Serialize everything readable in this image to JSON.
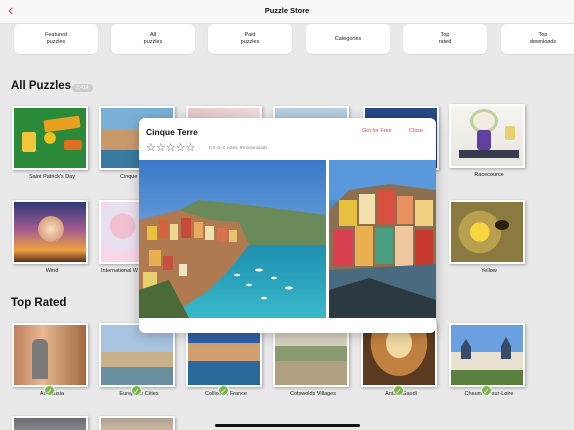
{
  "header": {
    "title": "Puzzle Store",
    "back_icon": "chevron-left-icon"
  },
  "chips": [
    "Featured\npuzzles",
    "All\npuzzles",
    "Paid\npuzzles",
    "Categories",
    "Top\nrated",
    "Top\ndownloads"
  ],
  "all_puzzles": {
    "heading": "All Puzzles",
    "badge": "2,414",
    "items": [
      "Saint Patrick's Day",
      "Cinque Terre",
      "",
      "",
      "",
      "Racecource",
      "Wind",
      "International W",
      "",
      "",
      "",
      "Yellow"
    ]
  },
  "top_rated": {
    "heading": "Top Rated",
    "items": [
      "Andalusia",
      "European Cities",
      "Collioure, France",
      "Cotswolds Villages",
      "Antoni Gaudi",
      "Chaumont-sur-Loire"
    ]
  },
  "modal": {
    "title": "Cinque Terre",
    "get_label": "Get for Free",
    "close_label": "Close",
    "stars": "☆☆☆☆☆",
    "rating_meta": "0.0 on 0 votes, 99 downloads"
  },
  "colors": {
    "accent": "#e0465a",
    "check": "#7ab547"
  }
}
